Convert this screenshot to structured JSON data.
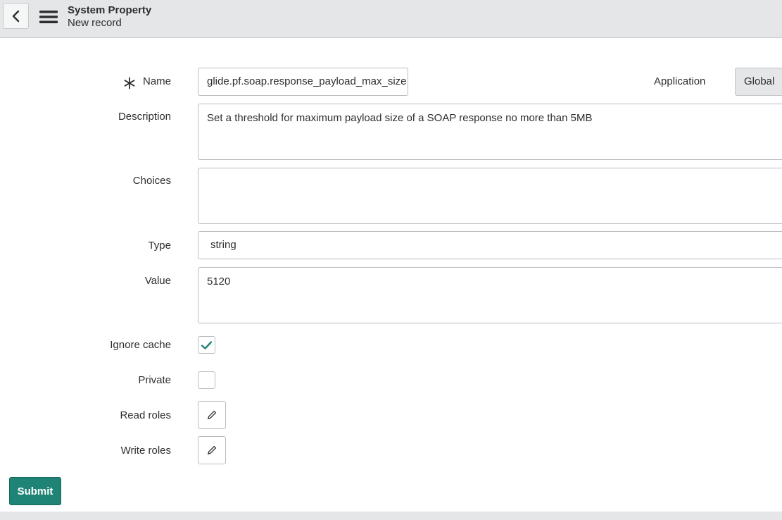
{
  "header": {
    "title": "System Property",
    "subtitle": "New record",
    "back_icon": "chevron-left-icon",
    "menu_icon": "hamburger-menu-icon"
  },
  "form": {
    "name": {
      "label": "Name",
      "value": "glide.pf.soap.response_payload_max_size",
      "required": true
    },
    "application": {
      "label": "Application",
      "value": "Global"
    },
    "description": {
      "label": "Description",
      "value": "Set a threshold for maximum payload size of a SOAP response no more than 5MB"
    },
    "choices": {
      "label": "Choices",
      "value": ""
    },
    "type": {
      "label": "Type",
      "value": "string"
    },
    "value": {
      "label": "Value",
      "value": "5120"
    },
    "ignore_cache": {
      "label": "Ignore cache",
      "checked": true
    },
    "private": {
      "label": "Private",
      "checked": false
    },
    "read_roles": {
      "label": "Read roles",
      "icon": "pencil-icon"
    },
    "write_roles": {
      "label": "Write roles",
      "icon": "pencil-icon"
    }
  },
  "actions": {
    "submit_label": "Submit"
  },
  "colors": {
    "header_bg": "#e4e6e7",
    "primary": "#1f8476",
    "check": "#1f8476"
  }
}
